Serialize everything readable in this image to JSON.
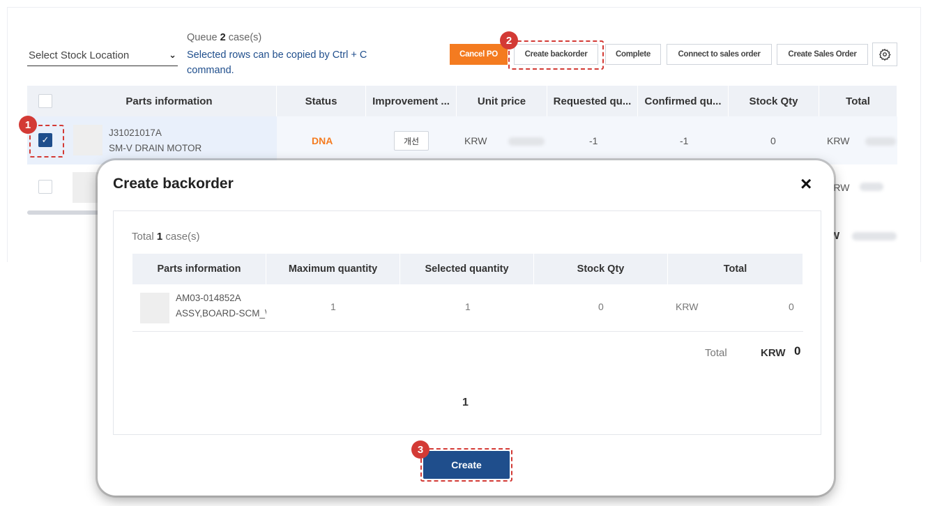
{
  "toolbar": {
    "stock_location_placeholder": "Select Stock Location",
    "queue_prefix": "Queue",
    "queue_count": "2",
    "queue_suffix": "case(s)",
    "copy_hint": "Selected rows can be copied by Ctrl + C command.",
    "buttons": {
      "cancel_po": "Cancel PO",
      "create_backorder": "Create backorder",
      "complete": "Complete",
      "connect_sales_order": "Connect to sales order",
      "create_sales_order": "Create Sales Order"
    },
    "accent_color": "#f47b20"
  },
  "table": {
    "headers": [
      "Parts information",
      "Status",
      "Improvement ...",
      "Unit price",
      "Requested qu...",
      "Confirmed qu...",
      "Stock Qty",
      "Total"
    ],
    "rows": [
      {
        "part_number": "J31021017A",
        "part_name": "SM-V DRAIN MOTOR",
        "status": "DNA",
        "improvement_button": "개선",
        "unit_price_currency": "KRW",
        "requested_qty": "-1",
        "confirmed_qty": "-1",
        "stock_qty": "0",
        "total_currency": "KRW",
        "checked": true
      },
      {
        "total_currency": "KRW",
        "checked": false
      }
    ],
    "footer_total_currency": "W"
  },
  "annotations": {
    "badge_1": "1",
    "badge_2": "2",
    "badge_3": "3",
    "color": "#d33a35"
  },
  "modal": {
    "title": "Create backorder",
    "close_icon": "×",
    "total_prefix": "Total",
    "total_count": "1",
    "total_suffix": "case(s)",
    "headers": [
      "Parts information",
      "Maximum quantity",
      "Selected quantity",
      "Stock Qty",
      "Total"
    ],
    "rows": [
      {
        "part_number": "AM03-014852A",
        "part_name": "ASSY,BOARD-SCM_\\",
        "max_qty": "1",
        "selected_qty": "1",
        "stock_qty": "0",
        "total_currency": "KRW",
        "total_value": "0"
      }
    ],
    "grand_total_label": "Total",
    "grand_total_currency": "KRW",
    "grand_total_value": "0",
    "page": "1",
    "create_button": "Create",
    "primary_color": "#1f4e8c"
  }
}
